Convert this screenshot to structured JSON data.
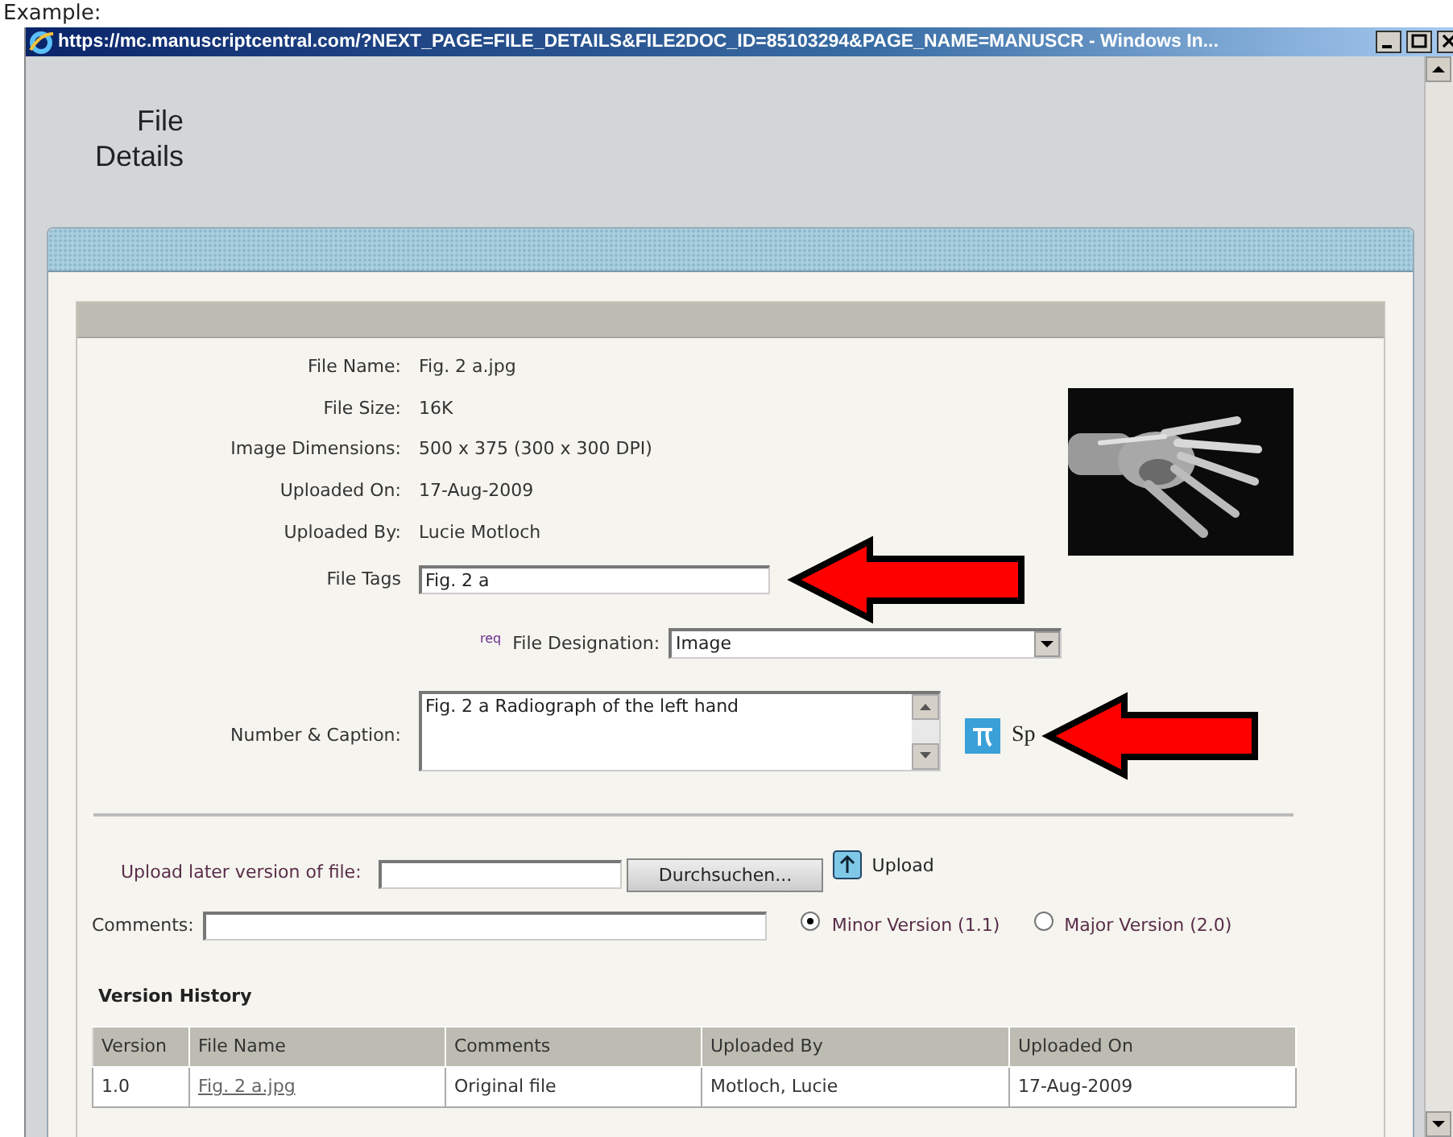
{
  "caption": "Example:",
  "window": {
    "title": "https://mc.manuscriptcentral.com/?NEXT_PAGE=FILE_DETAILS&FILE2DOC_ID=85103294&PAGE_NAME=MANUSCR - Windows In..."
  },
  "page_title": "File Details",
  "details": [
    {
      "label": "File Name:",
      "value": "Fig. 2 a.jpg"
    },
    {
      "label": "File Size:",
      "value": "16K"
    },
    {
      "label": "Image Dimensions:",
      "value": "500 x 375 (300 x 300 DPI)"
    },
    {
      "label": "Uploaded On:",
      "value": "17-Aug-2009"
    },
    {
      "label": "Uploaded By:",
      "value": "Lucie Motloch"
    }
  ],
  "file_tags": {
    "label": "File Tags",
    "value": "Fig. 2 a"
  },
  "file_designation": {
    "req": "req",
    "label": "File Designation:",
    "value": "Image"
  },
  "number_caption": {
    "label": "Number & Caption:",
    "value": "Fig. 2 a Radiograph of the left hand",
    "special": "Sp"
  },
  "upload": {
    "label": "Upload later version of file:",
    "browse": "Durchsuchen...",
    "button": "Upload"
  },
  "comments": {
    "label": "Comments:"
  },
  "versions": [
    {
      "label": "Minor Version (1.1)",
      "selected": true
    },
    {
      "label": "Major Version (2.0)",
      "selected": false
    }
  ],
  "history": {
    "title": "Version History",
    "columns": [
      "Version",
      "File Name",
      "Comments",
      "Uploaded By",
      "Uploaded On"
    ],
    "rows": [
      [
        "1.0",
        "Fig. 2 a.jpg",
        "Original file",
        "Motloch, Lucie",
        "17-Aug-2009"
      ]
    ]
  }
}
